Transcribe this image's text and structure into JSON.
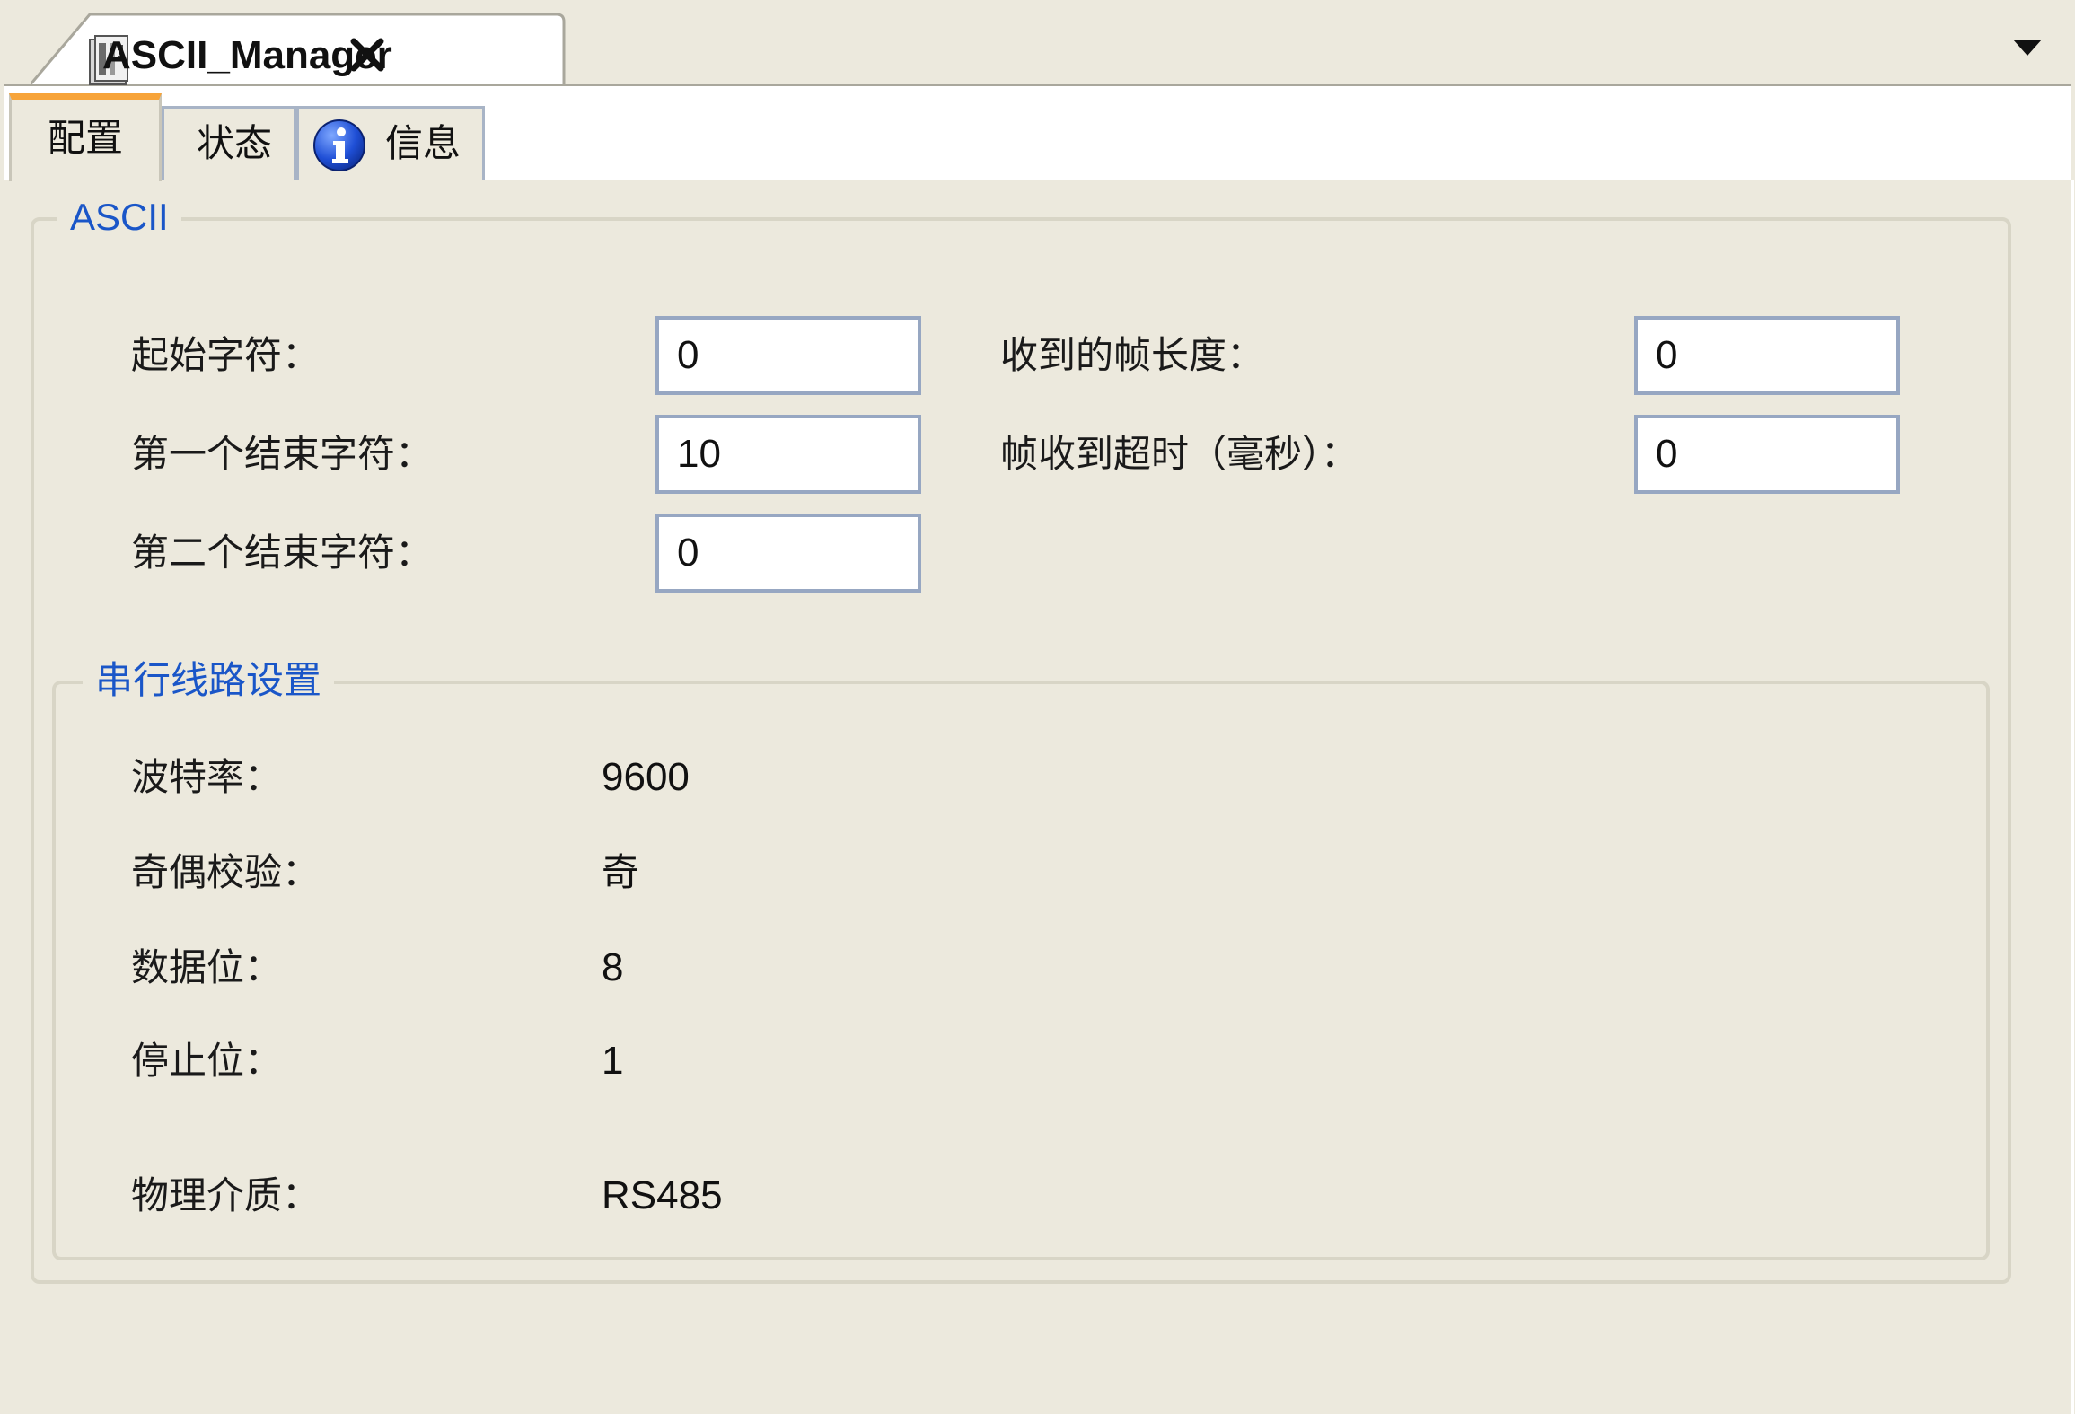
{
  "document_tab": {
    "title": "ASCII_Manager",
    "icon": "device-icon",
    "close_icon": "close-icon"
  },
  "tab_overflow_icon": "chevron-down-icon",
  "subtabs": [
    {
      "label": "配置",
      "active": true
    },
    {
      "label": "状态",
      "active": false
    },
    {
      "label": "信息",
      "active": false,
      "icon": "info-icon"
    }
  ],
  "ascii_group": {
    "title": "ASCII",
    "start_char": {
      "label": "起始字符：",
      "value": "0"
    },
    "first_end_char": {
      "label": "第一个结束字符：",
      "value": "10"
    },
    "second_end_char": {
      "label": "第二个结束字符：",
      "value": "0"
    },
    "frame_length": {
      "label": "收到的帧长度：",
      "value": "0"
    },
    "frame_timeout": {
      "label": "帧收到超时（毫秒）：",
      "value": "0"
    }
  },
  "serial_group": {
    "title": "串行线路设置",
    "baud_rate": {
      "label": "波特率：",
      "value": "9600"
    },
    "parity": {
      "label": "奇偶校验：",
      "value": "奇"
    },
    "data_bits": {
      "label": "数据位：",
      "value": "8"
    },
    "stop_bits": {
      "label": "停止位：",
      "value": "1"
    },
    "physical_medium": {
      "label": "物理介质：",
      "value": "RS485"
    }
  },
  "colors": {
    "background": "#ece9dd",
    "group_title": "#1a56c8",
    "active_tab_accent": "#f7a43a",
    "input_border": "#97a7c2"
  }
}
